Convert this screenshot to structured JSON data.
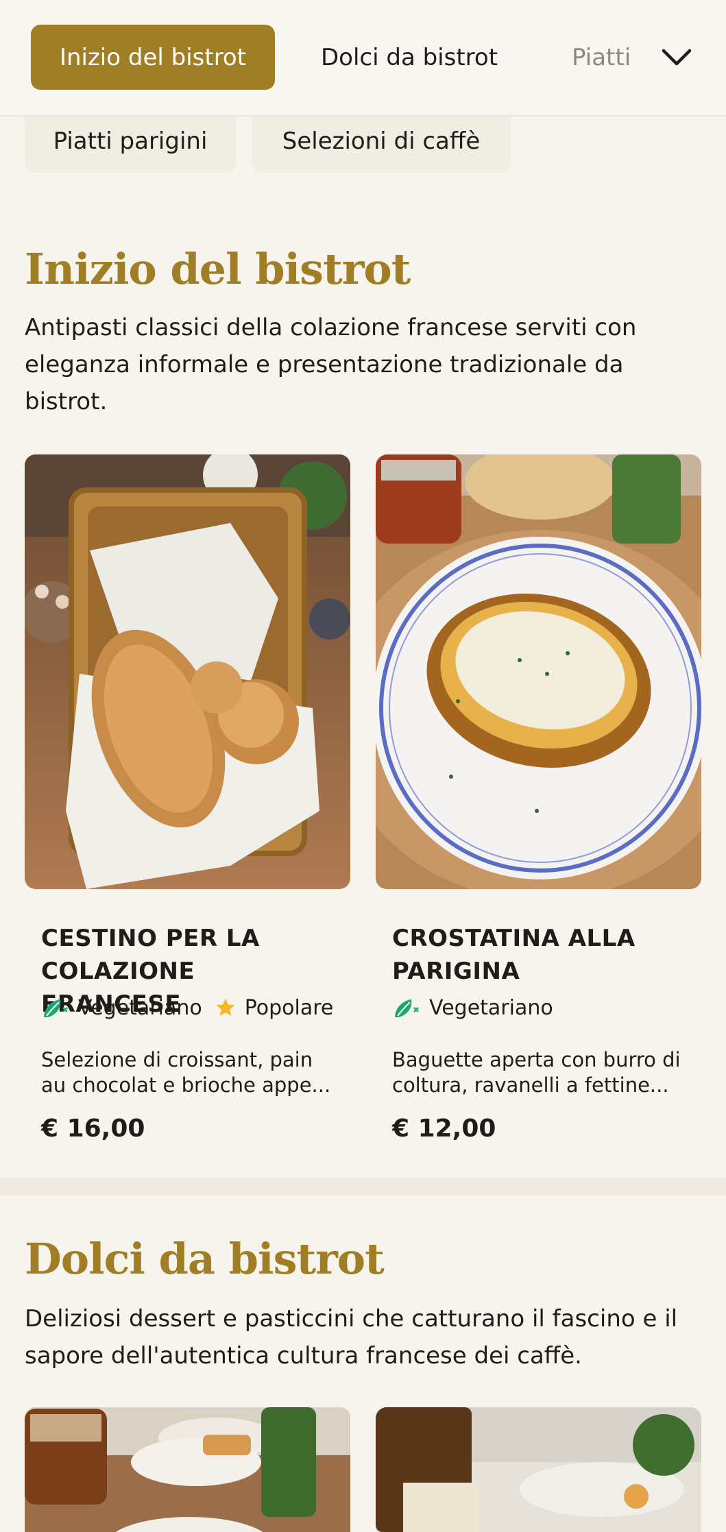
{
  "nav": {
    "tabs": [
      {
        "label": "Inizio del bistrot",
        "active": true
      },
      {
        "label": "Dolci da bistrot",
        "active": false
      },
      {
        "label": "Piatti parigini",
        "active": false
      }
    ],
    "more_icon": "chevron-down-icon"
  },
  "chips": [
    {
      "label": "Piatti parigini"
    },
    {
      "label": "Selezioni di caffè"
    }
  ],
  "colors": {
    "accent": "#a07e25",
    "background": "#f7f4ee",
    "veg_icon": "#1ea672",
    "star_icon": "#f2b822"
  },
  "sections": [
    {
      "title": "Inizio del bistrot",
      "description": "Antipasti classici della colazione francese serviti con eleganza informale e presentazione tradizionale da bistrot.",
      "items": [
        {
          "title": "CESTINO PER LA COLAZIONE FRANCESE",
          "tags": [
            {
              "label": "Vegetariano",
              "icon": "vegetarian-icon"
            },
            {
              "label": "Popolare",
              "icon": "star-icon"
            }
          ],
          "description": "Selezione di croissant, pain au chocolat e brioche appe...",
          "price": "€ 16,00",
          "image": "bread-basket-photo"
        },
        {
          "title": "CROSTATINA ALLA PARIGINA",
          "tags": [
            {
              "label": "Vegetariano",
              "icon": "vegetarian-icon"
            }
          ],
          "description": "Baguette aperta con burro di coltura, ravanelli a fettine...",
          "price": "€ 12,00",
          "image": "toast-plate-photo"
        }
      ]
    },
    {
      "title": "Dolci da bistrot",
      "description": "Deliziosi dessert e pasticcini che catturano il fascino e il sapore dell'autentica cultura francese dei caffè.",
      "items": [
        {
          "image": "dessert-table-photo"
        },
        {
          "image": "bottle-photo"
        }
      ]
    }
  ]
}
